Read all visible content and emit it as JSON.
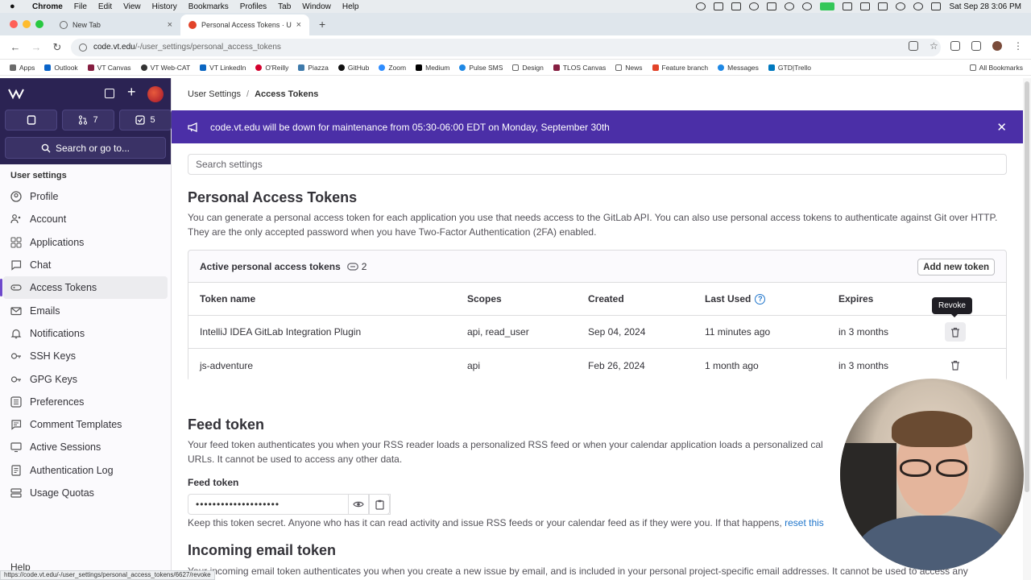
{
  "menubar": {
    "apple": "",
    "items": [
      "Chrome",
      "File",
      "Edit",
      "View",
      "History",
      "Bookmarks",
      "Profiles",
      "Tab",
      "Window",
      "Help"
    ],
    "datetime": "Sat Sep 28  3:06 PM"
  },
  "tabs": [
    {
      "label": "New Tab",
      "active": false
    },
    {
      "label": "Personal Access Tokens · Use",
      "active": true
    }
  ],
  "toolbar": {
    "url_host": "code.vt.edu",
    "url_path": "/-/user_settings/personal_access_tokens"
  },
  "bookmarks": {
    "items": [
      "Apps",
      "Outlook",
      "VT Canvas",
      "VT Web-CAT",
      "VT LinkedIn",
      "O'Reilly",
      "Piazza",
      "GitHub",
      "Zoom",
      "Medium",
      "Pulse SMS",
      "Design",
      "TLOS Canvas",
      "News",
      "Feature branch",
      "Messages",
      "GTD|Trello"
    ],
    "all": "All Bookmarks"
  },
  "sidebar": {
    "counter_mr": "7",
    "counter_todo": "5",
    "search_label": "Search or go to...",
    "section": "User settings",
    "items": [
      {
        "label": "Profile",
        "icon": "profile-icon"
      },
      {
        "label": "Account",
        "icon": "account-icon"
      },
      {
        "label": "Applications",
        "icon": "applications-icon"
      },
      {
        "label": "Chat",
        "icon": "chat-icon"
      },
      {
        "label": "Access Tokens",
        "icon": "token-icon"
      },
      {
        "label": "Emails",
        "icon": "mail-icon"
      },
      {
        "label": "Notifications",
        "icon": "bell-icon"
      },
      {
        "label": "SSH Keys",
        "icon": "key-icon"
      },
      {
        "label": "GPG Keys",
        "icon": "key-icon"
      },
      {
        "label": "Preferences",
        "icon": "preferences-icon"
      },
      {
        "label": "Comment Templates",
        "icon": "comment-icon"
      },
      {
        "label": "Active Sessions",
        "icon": "monitor-icon"
      },
      {
        "label": "Authentication Log",
        "icon": "log-icon"
      },
      {
        "label": "Usage Quotas",
        "icon": "quota-icon"
      }
    ],
    "help": "Help"
  },
  "breadcrumb": {
    "parent": "User Settings",
    "current": "Access Tokens"
  },
  "banner": {
    "text": "code.vt.edu will be down for maintenance from 05:30-06:00 EDT on Monday, September 30th"
  },
  "search": {
    "placeholder": "Search settings"
  },
  "pat": {
    "title": "Personal Access Tokens",
    "description": "You can generate a personal access token for each application you use that needs access to the GitLab API. You can also use personal access tokens to authenticate against Git over HTTP. They are the only accepted password when you have Two-Factor Authentication (2FA) enabled.",
    "card_title": "Active personal access tokens",
    "count": "2",
    "add_button": "Add new token",
    "columns": [
      "Token name",
      "Scopes",
      "Created",
      "Last Used",
      "Expires"
    ],
    "rows": [
      {
        "name": "IntelliJ IDEA GitLab Integration Plugin",
        "scopes": "api, read_user",
        "created": "Sep 04, 2024",
        "last_used": "11 minutes ago",
        "expires": "in 3 months"
      },
      {
        "name": "js-adventure",
        "scopes": "api",
        "created": "Feb 26, 2024",
        "last_used": "1 month ago",
        "expires": "in 3 months"
      }
    ],
    "tooltip": "Revoke"
  },
  "feed": {
    "title": "Feed token",
    "description": "Your feed token authenticates you when your RSS reader loads a personalized RSS feed or when your calendar application loads a personalized cal URLs. It cannot be used to access any other data.",
    "label": "Feed token",
    "value": "••••••••••••••••••••",
    "note": "Keep this token secret. Anyone who has it can read activity and issue RSS feeds or your calendar feed as if they were you. If that happens,",
    "link": "reset this"
  },
  "incoming": {
    "title": "Incoming email token",
    "description": "Your incoming email token authenticates you when you create a new issue by email, and is included in your personal project-specific email addresses. It cannot be used to access any"
  },
  "statusbar": "https://code.vt.edu/-/user_settings/personal_access_tokens/6627/revoke",
  "colors": {
    "sidebar_top": "#2b2353",
    "banner": "#4b2fa7",
    "accent": "#6e49cb",
    "link": "#1f75cb"
  }
}
